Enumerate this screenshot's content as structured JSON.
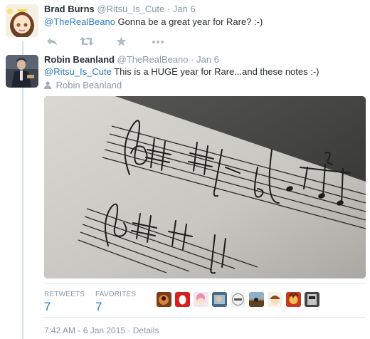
{
  "tweet1": {
    "name": "Brad Burns",
    "handle": "@Ritsu_Is_Cute",
    "sep": "·",
    "date": "Jan 6",
    "mention": "@TheRealBeano",
    "text": " Gonna be a great year for Rare?  :-)"
  },
  "actions": {
    "reply_icon": "reply-icon",
    "retweet_icon": "retweet-icon",
    "favorite_icon": "star-icon",
    "more_icon": "more-icon"
  },
  "tweet2": {
    "name": "Robin Beanland",
    "handle": "@TheRealBeano",
    "sep": "·",
    "date": "Jan 6",
    "mention": "@Ritsu_Is_Cute",
    "text": " This is a HUGE year for Rare...and these notes :-)",
    "tagged_user": "Robin Beanland"
  },
  "stats": {
    "retweets_label": "RETWEETS",
    "retweets_count": "7",
    "favorites_label": "FAVORITES",
    "favorites_count": "7"
  },
  "footer": {
    "timestamp": "7:42 AM - 6 Jan 2015",
    "sep": "·",
    "details": "Details"
  },
  "colors": {
    "link": "#2b7bb9",
    "meta": "#8899a6",
    "thread_line": "#cbe3f3"
  }
}
